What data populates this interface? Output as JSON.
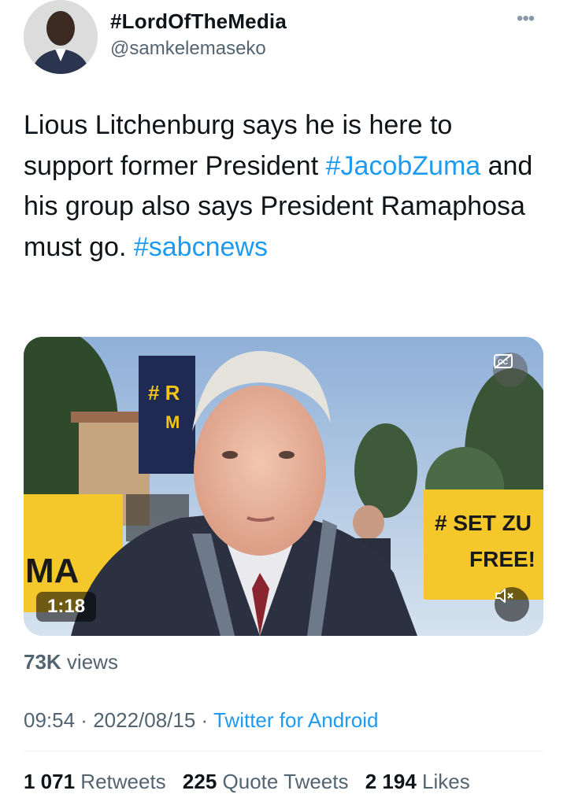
{
  "author": {
    "display_name": "#LordOfTheMedia",
    "handle": "@samkelemaseko"
  },
  "tweet": {
    "text_part1": "Lious Litchenburg says he is here to support former President ",
    "hashtag1": "#JacobZuma",
    "text_part2": " and his group also says President Ramaphosa must go. ",
    "hashtag2": "#sabcnews"
  },
  "media": {
    "duration": "1:18",
    "sign_left_top": "# R",
    "sign_left_top2": "M",
    "sign_left_bottom": "MA",
    "sign_right_line1": "# SET ZU",
    "sign_right_line2": "FREE!",
    "cc_icon": "closed-captions-icon",
    "mute_icon": "speaker-muted-icon"
  },
  "views": {
    "count": "73K",
    "label": " views"
  },
  "meta": {
    "time": "09:54",
    "separator": " · ",
    "date": "2022/08/15",
    "separator2": " · ",
    "source": "Twitter for Android"
  },
  "stats": {
    "retweets_count": "1 071",
    "retweets_label": " Retweets",
    "quotes_count": "225",
    "quotes_label": " Quote Tweets",
    "likes_count": "2 194",
    "likes_label": " Likes"
  },
  "colors": {
    "accent": "#1d9bf0",
    "secondary_text": "#536471",
    "primary_text": "#0f1419"
  }
}
